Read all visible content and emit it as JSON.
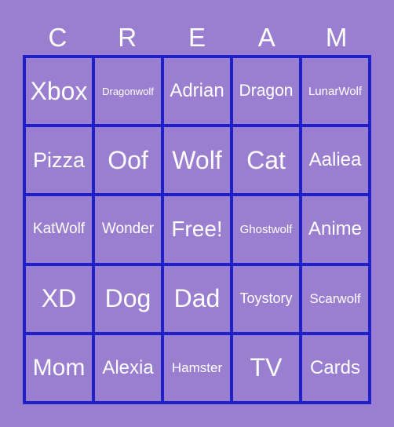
{
  "header": [
    "C",
    "R",
    "E",
    "A",
    "M"
  ],
  "cells": [
    "Xbox",
    "Dragonwolf",
    "Adrian",
    "Dragon",
    "LunarWolf",
    "Pizza",
    "Oof",
    "Wolf",
    "Cat",
    "Aaliea",
    "KatWolf",
    "Wonder",
    "Free!",
    "Ghostwolf",
    "Anime",
    "XD",
    "Dog",
    "Dad",
    "Toystory",
    "Scarwolf",
    "Mom",
    "Alexia",
    "Hamster",
    "TV",
    "Cards"
  ],
  "colors": {
    "background": "#9a7fd0",
    "border": "#2020c8",
    "text": "#ffffff"
  }
}
